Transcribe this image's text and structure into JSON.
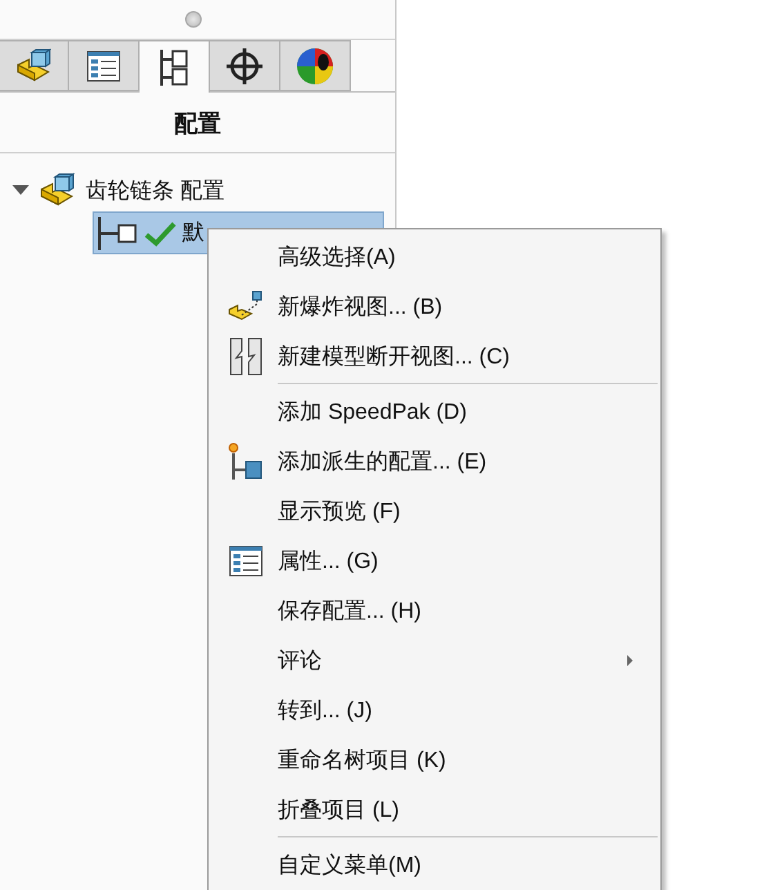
{
  "panel": {
    "tabs": [
      {
        "kind": "part",
        "selected": false
      },
      {
        "kind": "list",
        "selected": false
      },
      {
        "kind": "tree",
        "selected": true
      },
      {
        "kind": "crosshair",
        "selected": false
      },
      {
        "kind": "sphere",
        "selected": false
      }
    ],
    "title": "配置",
    "tree": [
      {
        "label": "齿轮链条 配置",
        "expanded": true,
        "children": [
          {
            "label": "默",
            "selected": true,
            "checked": true
          }
        ]
      }
    ]
  },
  "menu": {
    "items": [
      {
        "kind": "plain",
        "label": "高级选择(A)"
      },
      {
        "kind": "explode",
        "label": "新爆炸视图... (B)"
      },
      {
        "kind": "break",
        "label": "新建模型断开视图... (C)"
      },
      {
        "kind": "separator"
      },
      {
        "kind": "plain",
        "label": "添加 SpeedPak (D)"
      },
      {
        "kind": "derived",
        "label": "添加派生的配置... (E)"
      },
      {
        "kind": "plain",
        "label": "显示预览 (F)"
      },
      {
        "kind": "list",
        "label": "属性... (G)"
      },
      {
        "kind": "plain",
        "label": "保存配置... (H)"
      },
      {
        "kind": "submenu",
        "label": "评论"
      },
      {
        "kind": "plain",
        "label": "转到... (J)"
      },
      {
        "kind": "plain",
        "label": "重命名树项目 (K)"
      },
      {
        "kind": "plain",
        "label": "折叠项目 (L)"
      },
      {
        "kind": "separator"
      },
      {
        "kind": "plain",
        "label": "自定义菜单(M)"
      }
    ]
  }
}
